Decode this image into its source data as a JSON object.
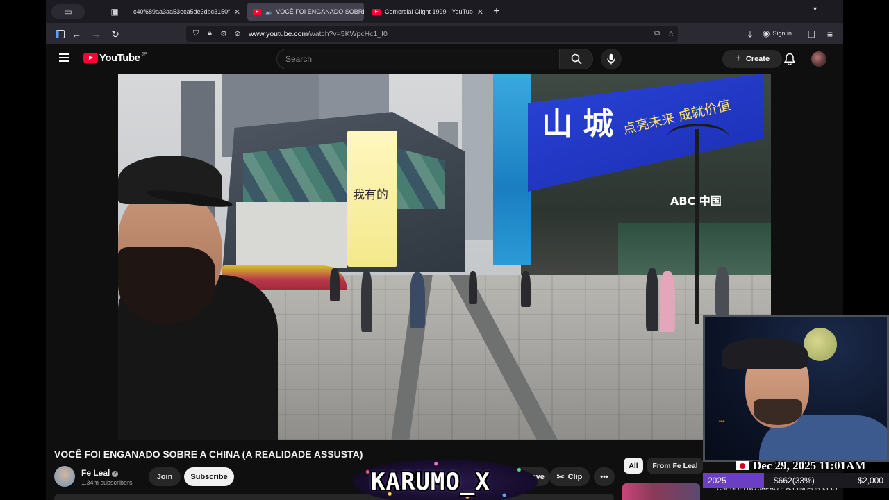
{
  "browser": {
    "tabs": [
      {
        "title": "c40f689aa3aa53eca5de3dbc3150f"
      },
      {
        "title": "VOCÊ FOI ENGANADO SOBRE"
      },
      {
        "title": "Comercial Clight 1999 - YouTub"
      }
    ],
    "url": {
      "host": "www.youtube.com",
      "path": "/watch?v=5KWpcHc1_I0"
    },
    "sign_in_label": "Sign in"
  },
  "youtube": {
    "logo_text": "YouTube",
    "region": "JP",
    "search_placeholder": "Search",
    "create_label": "Create"
  },
  "video": {
    "sign_text_yellow": "我有的",
    "sign_text_blue_1": "山 城",
    "sign_text_blue_2": "点亮未来 成就价值",
    "sign_text_bank": "ABC 中国",
    "title": "VOCÊ FOI ENGANADO SOBRE A CHINA (A REALIDADE ASSUSTA)",
    "channel": {
      "name": "Fe Leal",
      "subscribers": "1.34m subscribers"
    },
    "join_label": "Join",
    "subscribe_label": "Subscribe",
    "save_label": "Save",
    "clip_label": "Clip"
  },
  "sidebar": {
    "chips": [
      "All",
      "From Fe Leal"
    ],
    "rec_title": "CHEGUEI NO JAPÃO E ASSIM POR ISSO"
  },
  "overlay": {
    "banner_text": "KARUMO_X",
    "datetime": "Dec 29, 2025 11:01AM",
    "goal": {
      "year": "2025",
      "progress": "$662(33%)",
      "target": "$2,000",
      "fraction": 0.33
    }
  },
  "colors": {
    "youtube_red": "#ff0033",
    "goal_fill": "#6a3fc4",
    "browser_bg": "#1c1b22"
  }
}
